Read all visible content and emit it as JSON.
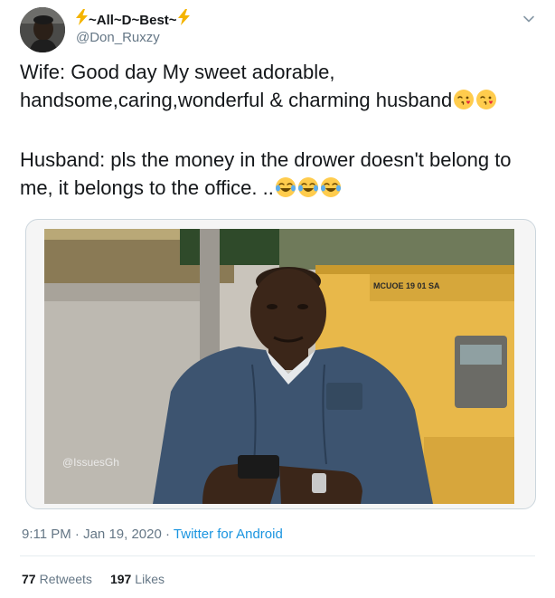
{
  "author": {
    "display_name": "~All~D~Best~",
    "handle": "@Don_Ruxzy",
    "name_decoration_icon": "lightning-bolt-icon"
  },
  "tweet": {
    "wife_text": "Wife: Good day My sweet adorable, handsome,caring,wonderful & charming husband",
    "wife_emojis": [
      "face-blowing-a-kiss",
      "face-blowing-a-kiss"
    ],
    "husband_text": "Husband: pls the money in the drower doesn't belong to me, it belongs to the office. ..",
    "husband_emojis": [
      "face-with-tears-of-joy",
      "face-with-tears-of-joy",
      "face-with-tears-of-joy"
    ]
  },
  "media": {
    "generator_label": "MCUOE 19 01 SA",
    "watermark": "@IssuesGh"
  },
  "meta": {
    "time": "9:11 PM",
    "separator": "·",
    "date": "Jan 19, 2020",
    "source": "Twitter for Android"
  },
  "stats": {
    "retweets_count": "77",
    "retweets_label": "Retweets",
    "likes_count": "197",
    "likes_label": "Likes"
  },
  "colors": {
    "text": "#14171a",
    "secondary": "#657786",
    "link": "#1b95e0",
    "bolt": "#f4b400",
    "divider": "#e6ecf0"
  }
}
